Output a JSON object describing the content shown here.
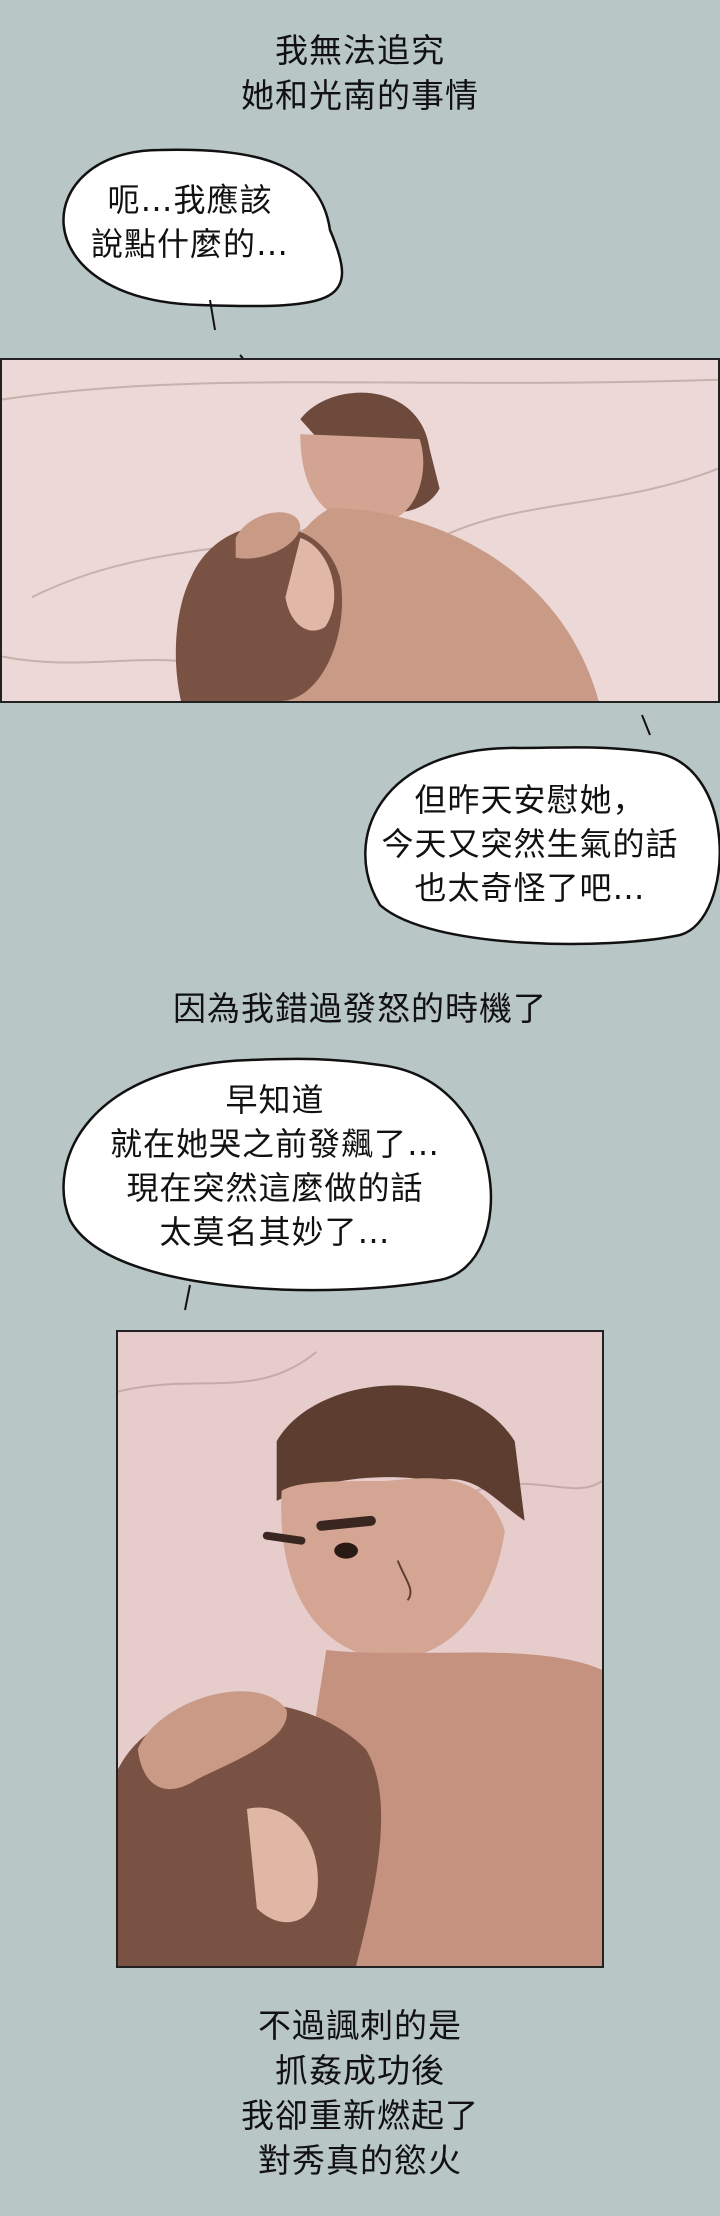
{
  "narration_1": [
    "我無法追究",
    "她和光南的事情"
  ],
  "bubble_1": [
    "呃…我應該",
    "說點什麼的…"
  ],
  "bubble_2": [
    "但昨天安慰她，",
    "今天又突然生氣的話",
    "也太奇怪了吧…"
  ],
  "narration_2": [
    "因為我錯過發怒的時機了"
  ],
  "bubble_3": [
    "早知道",
    "就在她哭之前發飆了…",
    "現在突然這麼做的話",
    "太莫名其妙了…"
  ],
  "narration_3": [
    "不過諷刺的是",
    "抓姦成功後",
    "我卻重新燃起了",
    "對秀真的慾火"
  ],
  "colors": {
    "background": "#b9c6c6",
    "panel_tone": "#e9d4d2",
    "skin": "#c99a86",
    "hair": "#6e4a3c"
  }
}
